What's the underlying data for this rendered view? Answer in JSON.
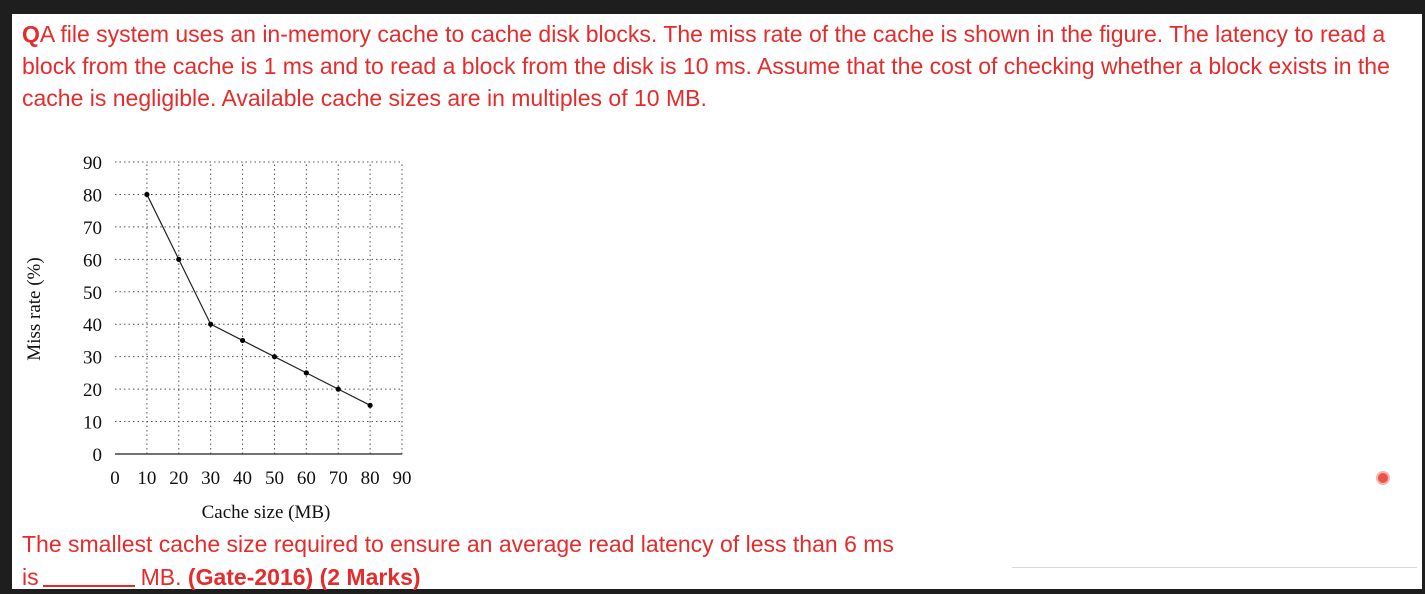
{
  "question": {
    "label": "Q",
    "text": "A file system uses an in-memory cache to cache disk blocks. The miss rate of the cache is shown in the figure. The latency to read a block from the cache is 1 ms and to read a block from the disk is 10 ms. Assume that the cost of checking whether a block exists in the cache is negligible. Available cache sizes are in multiples of 10 MB."
  },
  "answer": {
    "line": "The smallest cache size required to ensure an average read latency of less than 6 ms",
    "is_label": "is",
    "suffix": "MB.",
    "exam_ref": "(Gate-2016) (2 Marks)"
  },
  "colors": {
    "text_red": "#e52b2b",
    "grid": "#555555",
    "line": "#222222",
    "background": "#ffffff"
  },
  "chart_data": {
    "type": "line",
    "title": "",
    "xlabel": "Cache size (MB)",
    "ylabel": "Miss rate (%)",
    "x_ticks": [
      0,
      10,
      20,
      30,
      40,
      50,
      60,
      70,
      80,
      90
    ],
    "y_ticks": [
      0,
      10,
      20,
      30,
      40,
      50,
      60,
      70,
      80,
      90
    ],
    "xlim": [
      0,
      90
    ],
    "ylim": [
      0,
      90
    ],
    "grid": true,
    "grid_style": "dotted",
    "series": [
      {
        "x": [
          10,
          20,
          30,
          40,
          50,
          60,
          70,
          80
        ],
        "y": [
          80,
          60,
          40,
          35,
          30,
          25,
          20,
          15
        ]
      }
    ]
  }
}
